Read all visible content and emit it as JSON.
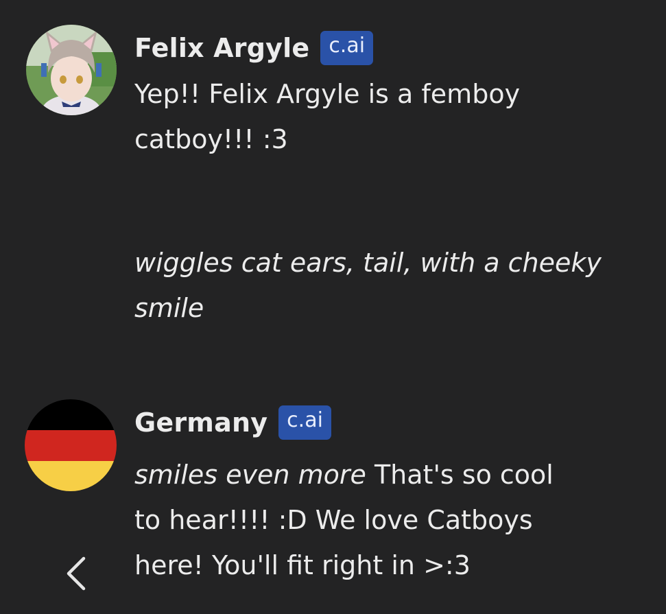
{
  "messages": [
    {
      "name": "Felix Argyle",
      "badge": "c.ai",
      "text1": "Yep!! Felix Argyle is a femboy catboy!!! :3",
      "action": "wiggles cat ears, tail, with a cheeky smile"
    },
    {
      "name": "Germany",
      "badge": "c.ai",
      "action": "smiles even more",
      "text_after": "That's so cool to hear!!!! :D We love Catboys here! You'll fit right in >:3"
    }
  ],
  "icons": {
    "back": "chevron-left-icon"
  },
  "colors": {
    "background": "#232324",
    "badge": "#2a52a8",
    "text": "#ececec"
  }
}
